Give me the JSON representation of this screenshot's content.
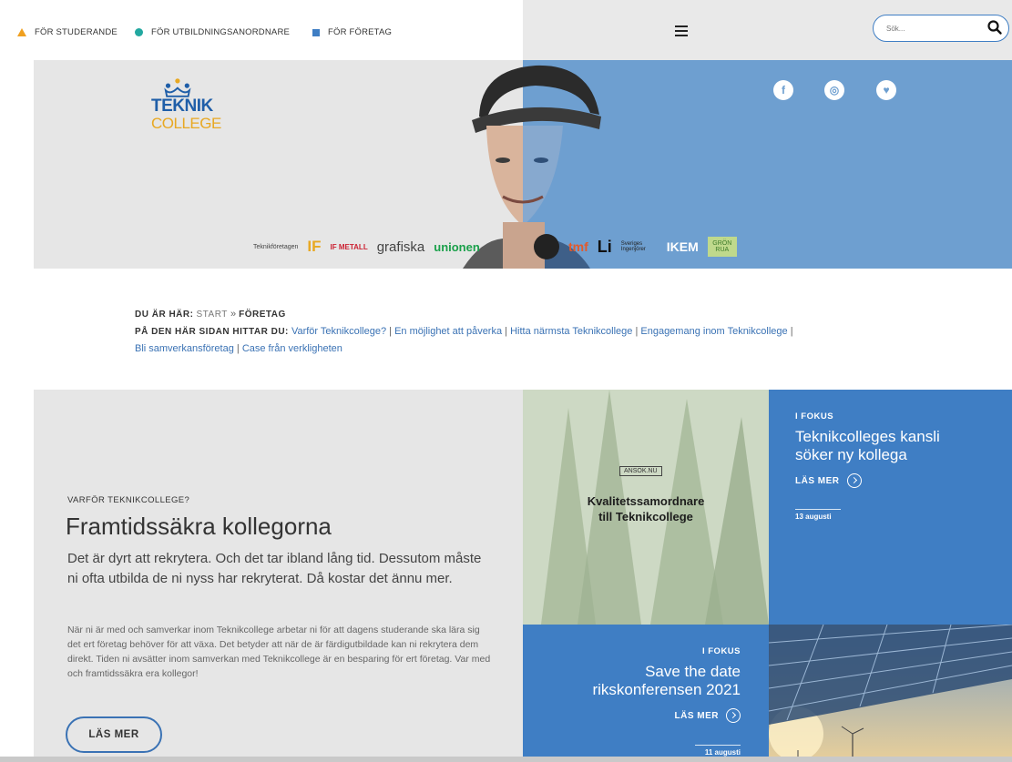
{
  "header": {
    "audiences": [
      {
        "label": "FÖR STUDERANDE",
        "color": "#f0a020"
      },
      {
        "label": "FÖR UTBILDNINGSANORDNARE",
        "color": "#22a8a0"
      },
      {
        "label": "FÖR FÖRETAG",
        "color": "#3f7ec4"
      }
    ],
    "search_placeholder": "Sök..."
  },
  "hero": {
    "logo_line1": "TEKNIK",
    "logo_line2": "COLLEGE",
    "social": [
      "facebook-icon",
      "instagram-icon",
      "twitter-icon"
    ],
    "partners_left": [
      "Teknikföretagen",
      "IF",
      "IF METALL",
      "grafiska",
      "unionen"
    ],
    "partners_right": [
      "tmf",
      "Li",
      "Sveriges Ingenjörer",
      "IKEM",
      "GRÖN RUA"
    ]
  },
  "breadcrumb": {
    "label": "DU ÄR HÄR:",
    "start": "START",
    "separator": "»",
    "current": "FÖRETAG",
    "onpage_label": "PÅ DEN HÄR SIDAN HITTAR DU:",
    "links": [
      "Varför Teknikcollege?",
      "En möjlighet att påverka",
      "Hitta närmsta Teknikcollege",
      "Engagemang inom Teknikcollege",
      "Bli samverkansföretag",
      "Case från verkligheten"
    ],
    "link_separator": "|"
  },
  "intro": {
    "kicker": "VARFÖR TEKNIKCOLLEGE?",
    "title": "Framtidssäkra kollegorna",
    "lead": "Det är dyrt att rekrytera. Och det tar ibland lång tid. Dessutom måste ni ofta utbilda de ni nyss har rekryterat. Då kostar det ännu mer.",
    "body": "När ni är med och samverkar inom Teknikcollege arbetar ni för att dagens studerande ska lära sig det ert företag behöver för att växa. Det betyder att när de är färdigutbildade kan ni rekrytera dem direkt. Tiden ni avsätter inom samverkan med Teknikcollege är en besparing för ert företag. Var med och framtidssäkra era kollegor!",
    "button": "LÄS MER"
  },
  "ad": {
    "tag": "ANSOK.NU",
    "title_line1": "Kvalitetssamordnare",
    "title_line2": "till Teknikcollege"
  },
  "focus1": {
    "kicker": "I FOKUS",
    "title": "Teknikcolleges kansli söker ny kollega",
    "more": "LÄS MER",
    "date": "13 augusti"
  },
  "focus2": {
    "kicker": "I FOKUS",
    "title": "Save the date rikskonferensen 2021",
    "more": "LÄS MER",
    "date": "11 augusti"
  }
}
